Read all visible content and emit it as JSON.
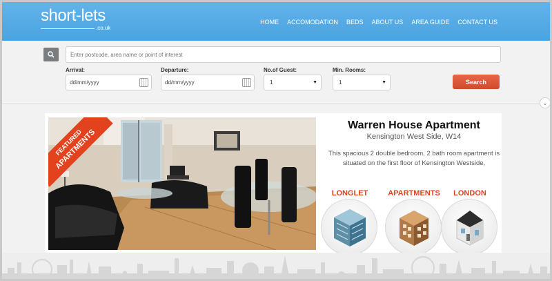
{
  "header": {
    "logo_text": "short-lets",
    "logo_sub": ".co.uk",
    "nav": [
      "HOME",
      "ACCOMODATION",
      "BEDS",
      "ABOUT US",
      "AREA GUIDE",
      "CONTACT US"
    ]
  },
  "search": {
    "placeholder": "Enter postcode, area name or point of interest",
    "arrival_label": "Arrival:",
    "arrival_value": "dd/mm/yyyy",
    "departure_label": "Departure:",
    "departure_value": "dd/mm/yyyy",
    "guests_label": "No.of Guest:",
    "guests_value": "1",
    "rooms_label": "Min. Rooms:",
    "rooms_value": "1",
    "button_label": "Search"
  },
  "featured": {
    "ribbon_line1": "FEATURED",
    "ribbon_line2": "APARTMENTS",
    "title": "Warren House Apartment",
    "subtitle": "Kensington West Side, W14",
    "description": "This spacious 2 double bedroom, 2 bath room apartment is situated on the first floor of Kensington Westside,",
    "tags": [
      "LONGLET",
      "APARTMENTS",
      "LONDON"
    ]
  },
  "colors": {
    "header_blue": "#4aa3e0",
    "accent_orange": "#d9441f",
    "search_button": "#d14a2c"
  }
}
